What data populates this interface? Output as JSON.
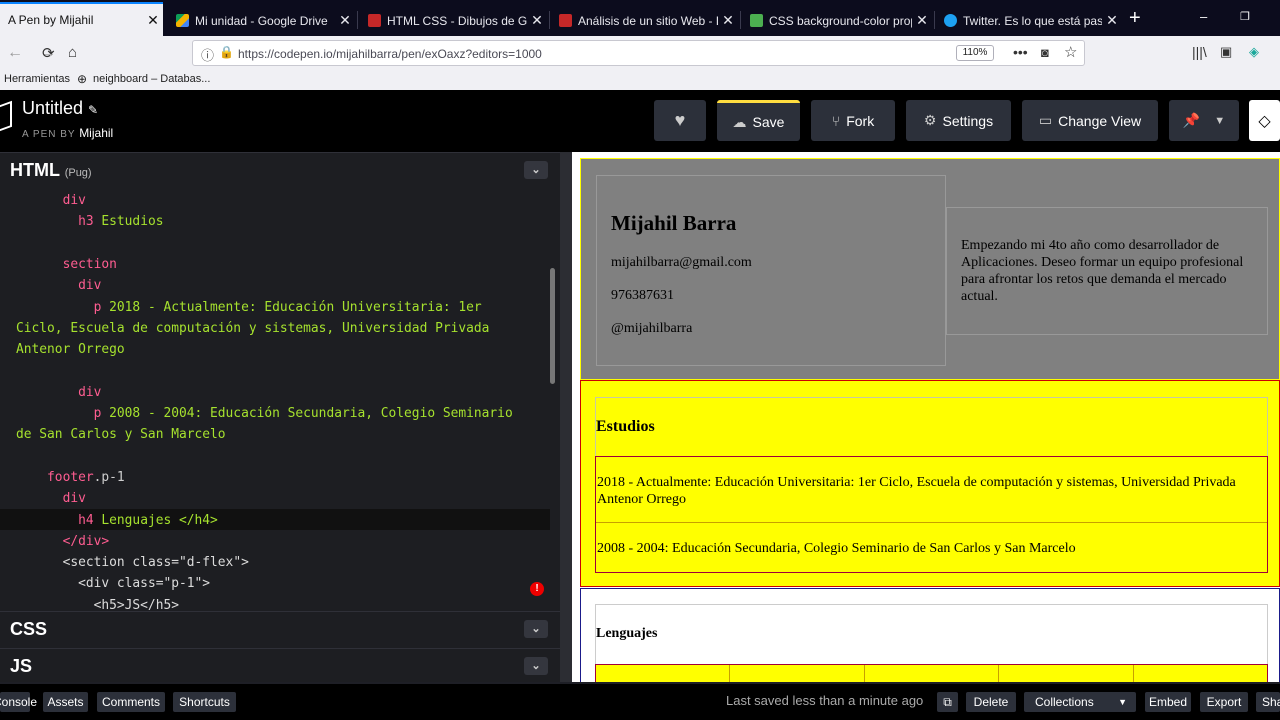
{
  "browser": {
    "tabs": [
      {
        "label": "A Pen by Mijahil",
        "active": true,
        "icon": "codepen-icon"
      },
      {
        "label": "Mi unidad - Google Drive",
        "icon": "drive-icon"
      },
      {
        "label": "HTML CSS - Dibujos de Googl",
        "icon": "slides-icon"
      },
      {
        "label": "Análisis de un sitio Web - Dib",
        "icon": "slides-icon"
      },
      {
        "label": "CSS background-color propert",
        "icon": "w3-icon"
      },
      {
        "label": "Twitter. Es lo que está pasand",
        "icon": "twitter-icon"
      }
    ],
    "new_tab": "+",
    "url": "https://codepen.io/mijahilbarra/pen/exOaxz?editors=1000",
    "zoom": "110%",
    "bookmarks": [
      "Herramientas",
      "neighboard – Databas..."
    ]
  },
  "pen": {
    "title": "Untitled",
    "byline": "A PEN BY",
    "author": "Mijahil"
  },
  "actions": {
    "save": "Save",
    "fork": "Fork",
    "settings": "Settings",
    "change_view": "Change View"
  },
  "editors": {
    "html_label": "HTML",
    "html_lang": "(Pug)",
    "css_label": "CSS",
    "js_label": "JS"
  },
  "code_lines": [
    {
      "indent": "    ",
      "kw": "div",
      "text": ""
    },
    {
      "indent": "      ",
      "kw": "h3",
      "text": " Estudios"
    },
    {
      "indent": "",
      "kw": "",
      "text": ""
    },
    {
      "indent": "    ",
      "kw": "section",
      "text": ""
    },
    {
      "indent": "      ",
      "kw": "div",
      "text": ""
    },
    {
      "indent": "        ",
      "kw": "p",
      "text": " 2018 - Actualmente: Educación Universitaria: 1er"
    },
    {
      "indent": "",
      "kw": "",
      "text": "Ciclo, Escuela de computación y sistemas, Universidad Privada"
    },
    {
      "indent": "",
      "kw": "",
      "text": "Antenor Orrego"
    },
    {
      "indent": "",
      "kw": "",
      "text": ""
    },
    {
      "indent": "      ",
      "kw": "div",
      "text": ""
    },
    {
      "indent": "        ",
      "kw": "p",
      "text": " 2008 - 2004: Educación Secundaria, Colegio Seminario"
    },
    {
      "indent": "",
      "kw": "",
      "text": "de San Carlos y San Marcelo"
    },
    {
      "indent": "",
      "kw": "",
      "text": ""
    },
    {
      "indent": "  ",
      "kw": "footer",
      "sy": ".p-1",
      "text": ""
    },
    {
      "indent": "    ",
      "kw": "div",
      "text": ""
    },
    {
      "indent": "      ",
      "kw": "h4",
      "text": " Lenguajes </h4>"
    },
    {
      "indent": "    ",
      "kw": "</div>",
      "text": ""
    },
    {
      "indent": "    ",
      "kw": "",
      "html": "<section class=\"d-flex\">"
    },
    {
      "indent": "      ",
      "kw": "",
      "html": "<div class=\"p-1\">"
    },
    {
      "indent": "        ",
      "kw": "",
      "html": "<h5>JS</h5>"
    }
  ],
  "preview": {
    "name": "Mijahil Barra",
    "email": "mijahilbarra@gmail.com",
    "phone": "976387631",
    "handle": "@mijahilbarra",
    "about": "Empezando mi 4to año como desarrollador de Aplicaciones. Deseo formar un equipo profesional para afrontar los retos que demanda el mercado actual.",
    "studies_title": "Estudios",
    "study_1": "2018 - Actualmente: Educación Universitaria: 1er Ciclo, Escuela de computación y sistemas, Universidad Privada Antenor Orrego",
    "study_2": "2008 - 2004: Educación Secundaria, Colegio Seminario de San Carlos y San Marcelo",
    "languages_title": "Lenguajes"
  },
  "footer": {
    "console": "Console",
    "assets": "Assets",
    "comments": "Comments",
    "shortcuts": "Shortcuts",
    "status": "Last saved less than a minute ago",
    "delete": "Delete",
    "collections": "Collections",
    "embed": "Embed",
    "export": "Export",
    "share": "Share"
  },
  "colors": {
    "accent": "#ffdd40",
    "yellow": "#ffff00",
    "preview_bg": "#808080"
  }
}
